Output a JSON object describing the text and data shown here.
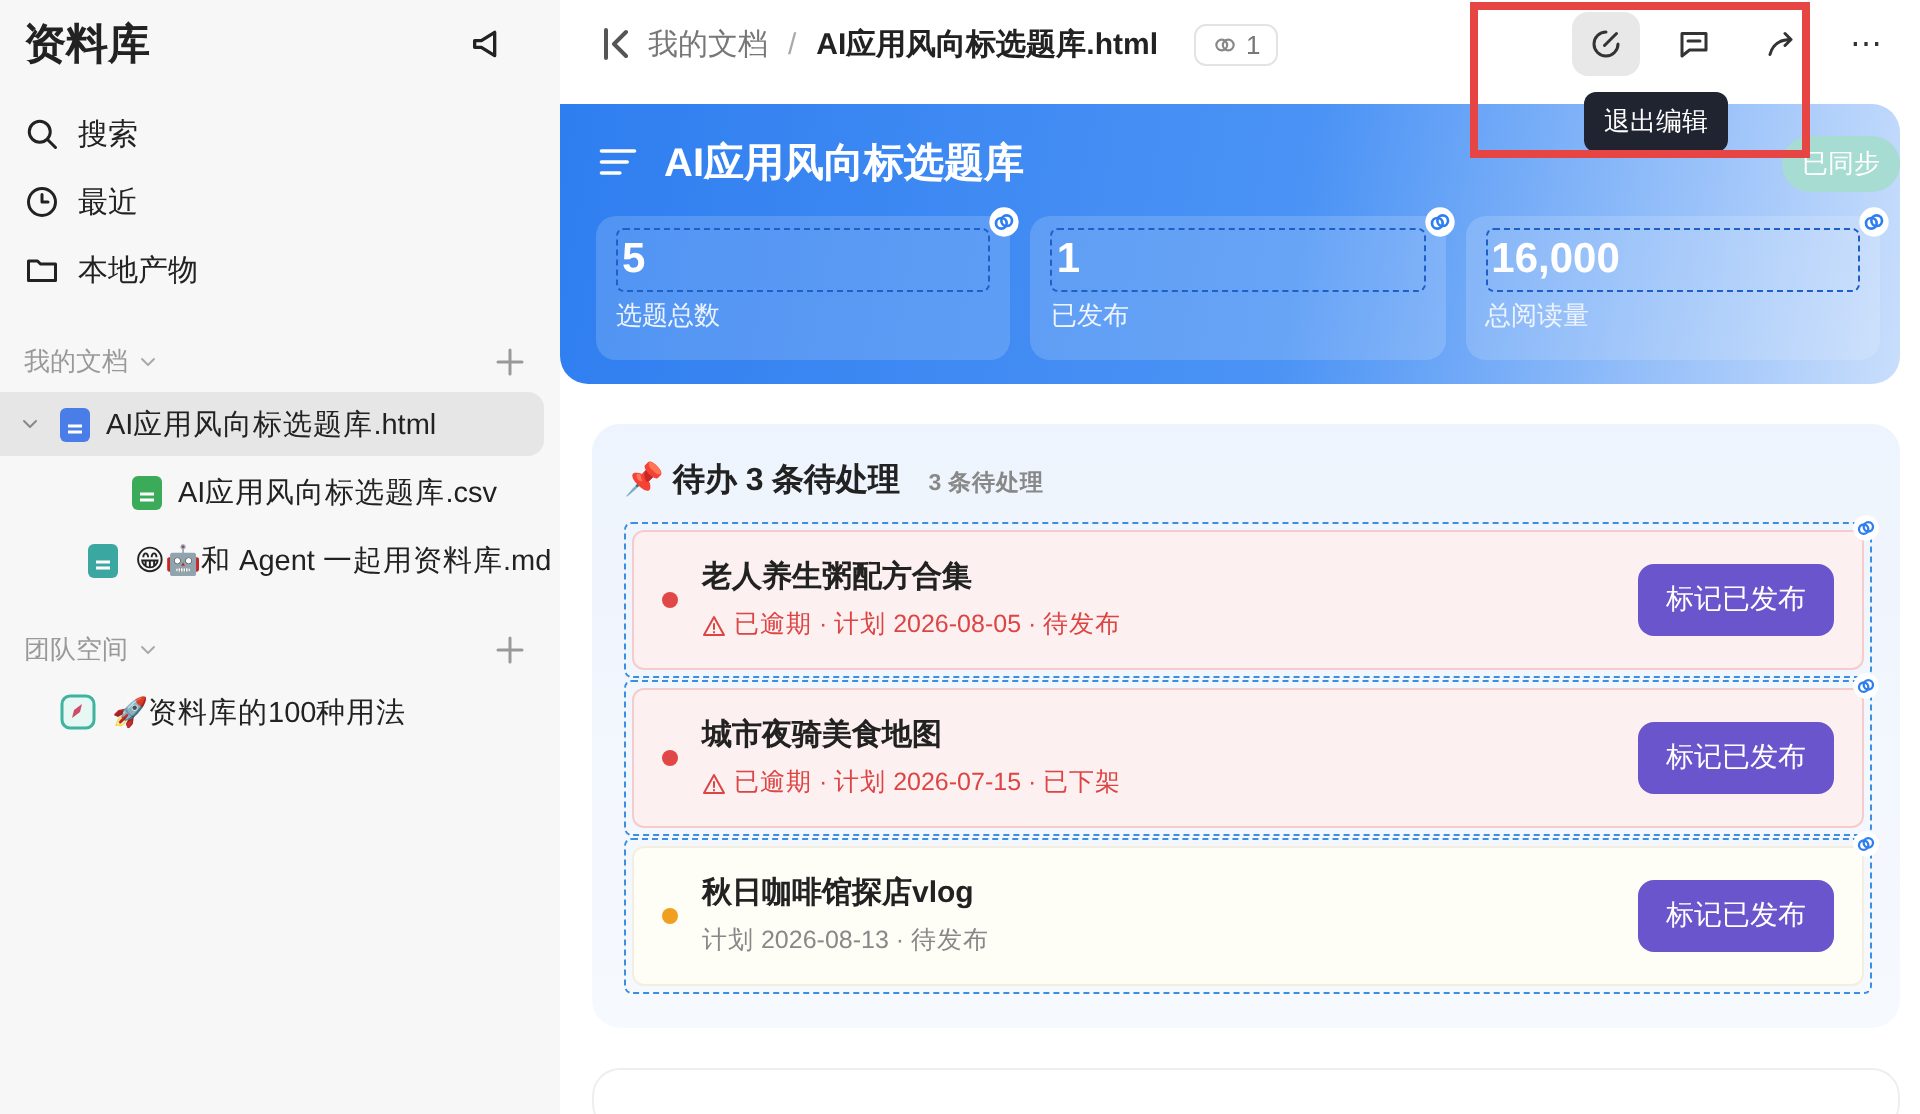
{
  "sidebar": {
    "title": "资料库",
    "nav": [
      {
        "label": "搜索",
        "kind": "search"
      },
      {
        "label": "最近",
        "kind": "clock"
      },
      {
        "label": "本地产物",
        "kind": "folder"
      }
    ],
    "sections": [
      {
        "title": "我的文档",
        "items": [
          {
            "label": "AI应用风向标选题库.html",
            "kind": "html",
            "selected": true,
            "expanded": true,
            "children": [
              {
                "label": "AI应用风向标选题库.csv",
                "kind": "csv",
                "selected": false
              }
            ]
          },
          {
            "label": "😁🤖和 Agent 一起用资料库.md",
            "kind": "md",
            "selected": false
          }
        ]
      },
      {
        "title": "团队空间",
        "items": [
          {
            "label": "🚀资料库的100种用法",
            "kind": "rocket",
            "selected": false
          }
        ]
      }
    ]
  },
  "header": {
    "breadcrumb": [
      "我的文档",
      "AI应用风向标选题库.html"
    ],
    "separator": "/",
    "link_count": "1",
    "more": "⋯",
    "tooltip": "退出编辑"
  },
  "banner": {
    "title": "AI应用风向标选题库",
    "badge": "已同步",
    "stats": [
      {
        "value": "5",
        "label": "选题总数"
      },
      {
        "value": "1",
        "label": "已发布"
      },
      {
        "value": "16,000",
        "label": "总阅读量"
      }
    ]
  },
  "todo": {
    "title": "📌 待办 3 条待处理",
    "subtitle": "3 条待处理",
    "items": [
      {
        "title": "老人养生粥配方合集",
        "meta": "已逾期 · 计划 2026-08-05 · 待发布",
        "kind": "overdue",
        "color": "#e04848",
        "button": "标记已发布"
      },
      {
        "title": "城市夜骑美食地图",
        "meta": "已逾期 · 计划 2026-07-15 · 已下架",
        "kind": "overdue",
        "color": "#e04848",
        "button": "标记已发布"
      },
      {
        "title": "秋日咖啡馆探店vlog",
        "meta": "计划 2026-08-13 · 待发布",
        "kind": "normal",
        "color": "#f0a020",
        "button": "标记已发布"
      }
    ]
  }
}
